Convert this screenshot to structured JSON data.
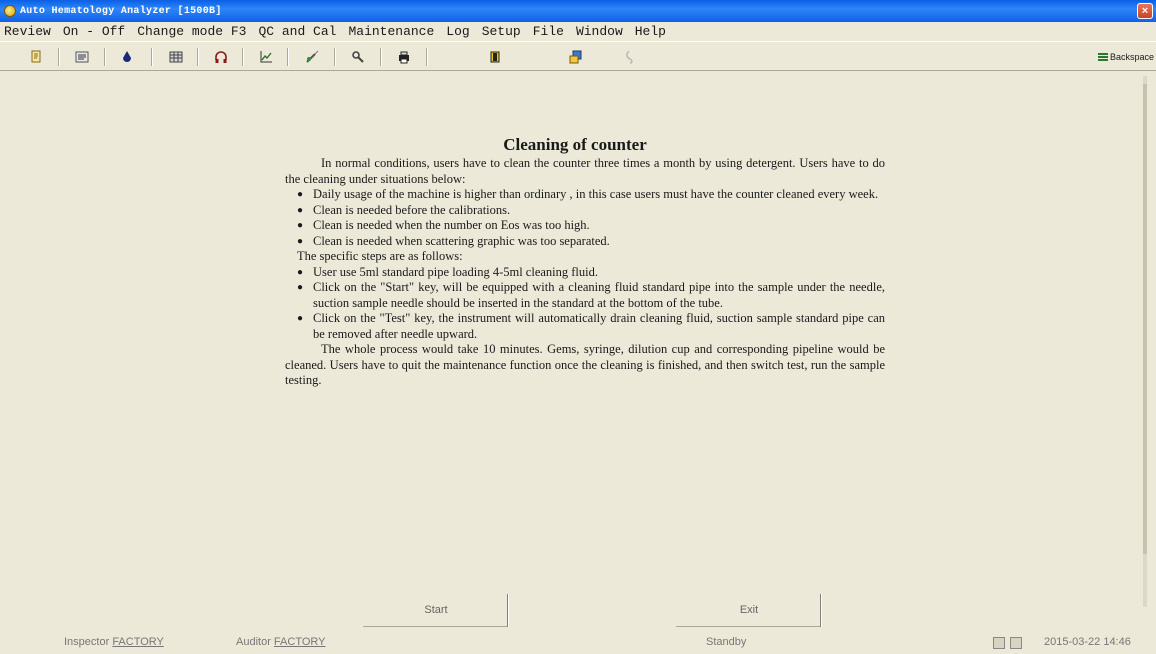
{
  "window": {
    "title": "Auto Hematology Analyzer  [1500B]",
    "close_glyph": "×"
  },
  "menu": [
    {
      "label": "Review"
    },
    {
      "label": "On - Off"
    },
    {
      "label": "Change mode F3"
    },
    {
      "label": "QC and Cal"
    },
    {
      "label": "Maintenance"
    },
    {
      "label": "Log"
    },
    {
      "label": "Setup"
    },
    {
      "label": "File"
    },
    {
      "label": "Window"
    },
    {
      "label": "Help"
    }
  ],
  "toolbar": {
    "buttons": [
      {
        "icon": "new-sample-icon"
      },
      {
        "icon": "list-icon"
      },
      {
        "icon": "drop-icon"
      },
      {
        "icon": "grid-icon"
      },
      {
        "icon": "headphone-icon"
      },
      {
        "icon": "chart-icon"
      },
      {
        "icon": "syringe-icon"
      },
      {
        "icon": "wrench-icon"
      },
      {
        "icon": "print-icon"
      },
      {
        "icon": "barrier-icon"
      },
      {
        "icon": "report-icon"
      },
      {
        "icon": "busy-icon"
      }
    ],
    "backspace_label": "Backspace"
  },
  "doc": {
    "title": "Cleaning of counter",
    "intro": "In normal conditions, users have to clean the counter three times a month by using detergent. Users have to do the cleaning under situations below:",
    "situations": [
      "Daily usage of the machine is higher than ordinary , in this case users must have the counter cleaned every week.",
      "Clean is needed before the calibrations.",
      "Clean is needed when the number on Eos was too high.",
      "Clean is needed when scattering graphic was too separated."
    ],
    "steps_heading": "The specific steps are as follows:",
    "steps": [
      "User use 5ml standard pipe loading 4-5ml cleaning fluid.",
      "Click on the \"Start\" key, will be equipped with a cleaning fluid standard pipe into the sample under the needle, suction sample needle should be inserted in the standard at the bottom of the tube.",
      "Click on the \"Test\" key, the instrument will automatically drain cleaning fluid, suction sample standard pipe can be removed after needle upward."
    ],
    "closing": "The whole process would take 10 minutes. Gems, syringe, dilution cup and corresponding pipeline would be cleaned. Users have to quit the maintenance function once the cleaning is finished, and then switch test, run the sample testing.",
    "bullet": "●"
  },
  "actions": {
    "start_label": "Start",
    "exit_label": "Exit"
  },
  "status": {
    "inspector_label": "Inspector",
    "inspector_value": "FACTORY",
    "auditor_label": "Auditor",
    "auditor_value": "FACTORY",
    "state": "Standby",
    "datetime": "2015-03-22 14:46"
  }
}
